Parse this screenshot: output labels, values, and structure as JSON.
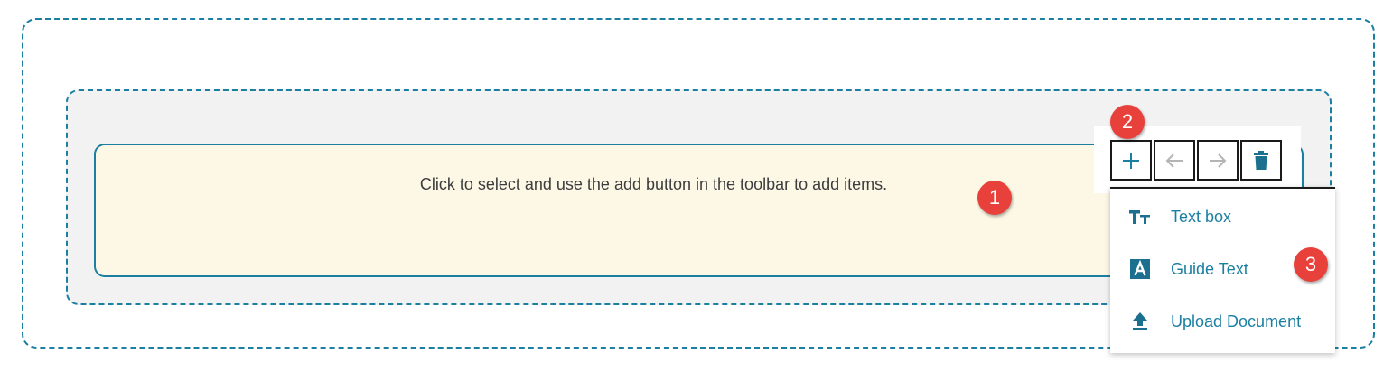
{
  "canvas": {
    "hint_text": "Click to select and use the add button in the toolbar to add items."
  },
  "toolbar": {
    "buttons": [
      {
        "icon": "plus-icon",
        "label": "add"
      },
      {
        "icon": "arrow-left-icon",
        "label": "move left"
      },
      {
        "icon": "arrow-right-icon",
        "label": "move right"
      },
      {
        "icon": "trash-icon",
        "label": "delete"
      }
    ]
  },
  "add_menu": {
    "items": [
      {
        "label": "Text box",
        "icon": "text-size-icon"
      },
      {
        "label": "Guide Text",
        "icon": "letter-a-icon"
      },
      {
        "label": "Upload Document",
        "icon": "upload-icon"
      }
    ]
  },
  "callouts": [
    "1",
    "2",
    "3"
  ],
  "colors": {
    "accent": "#1b7fa2",
    "callout": "#e8413b",
    "content_bg": "#fdf8e6",
    "panel_bg": "#f2f2f2"
  }
}
